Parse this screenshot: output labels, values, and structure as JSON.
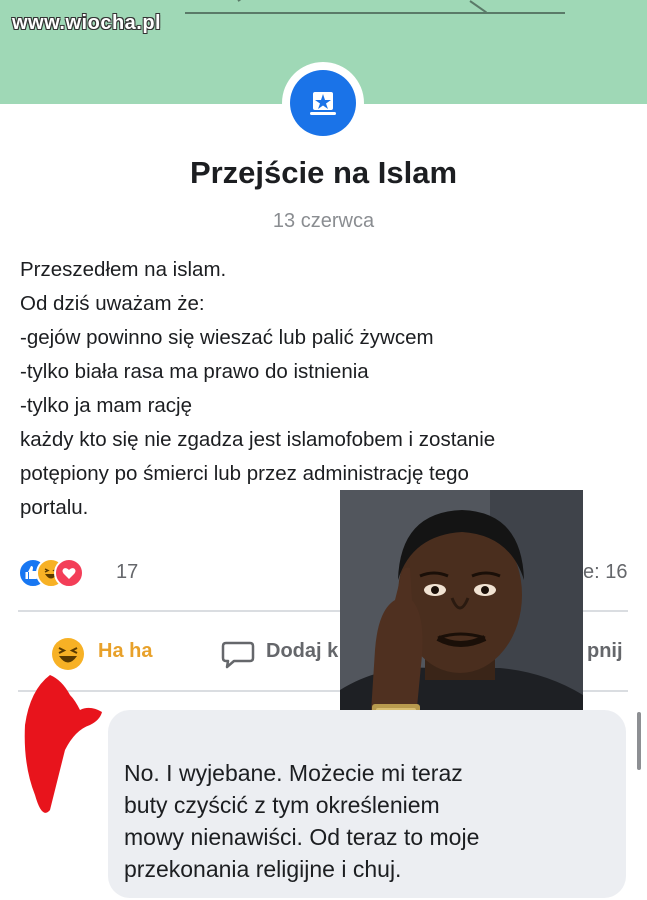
{
  "watermark": "www.wiocha.pl",
  "event": {
    "title": "Przejście na Islam",
    "date": "13 czerwca"
  },
  "post": {
    "lines": [
      "Przeszedłem na islam.",
      "Od dziś uważam że:",
      "-gejów powinno się wieszać lub palić żywcem",
      "-tylko biała rasa ma prawo do istnienia",
      "-tylko ja mam rację",
      "każdy kto się nie zgadza jest islamofobem i zostanie",
      "potępiony po śmierci lub przez administrację tego",
      "portalu."
    ]
  },
  "reactions": {
    "count": "17",
    "comments_fragment": "e: 16",
    "icons": [
      "like-icon",
      "haha-icon",
      "love-icon"
    ]
  },
  "actions": {
    "haha_label": "Ha ha",
    "comment_label": "Dodaj k",
    "share_label": "pnij"
  },
  "comment": {
    "lines": [
      "No. I wyjebane. Możecie mi teraz",
      "buty czyścić z tym określeniem",
      "mowy nienawiści. Od teraz to moje",
      "przekonania religijne i chuj."
    ]
  },
  "colors": {
    "cover": "#9fd8b6",
    "accent_blue": "#1a73e8",
    "haha_orange": "#e8a12a",
    "scribble_red": "#e8141c",
    "bubble_gray": "#eceef2"
  }
}
